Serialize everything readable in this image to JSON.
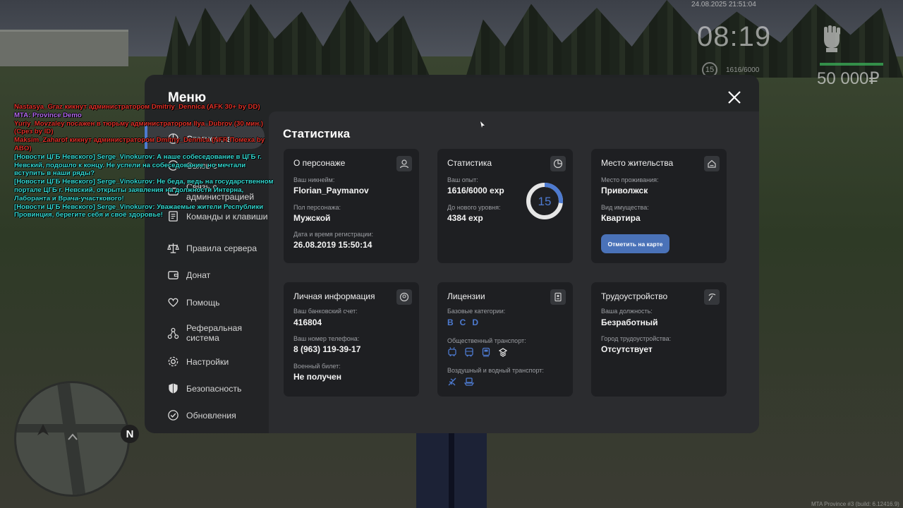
{
  "hud": {
    "datetime": "24.08.2025 21:51:04",
    "clock": "08:19",
    "level": "15",
    "exp": "1616/6000",
    "money": "50 000₽"
  },
  "chat": [
    {
      "text": "Nastasya_Graz кикнут администратором Dmitriy_Dennica (AFK 30+ by DD)",
      "color": "red"
    },
    {
      "text": "MTA: Province Demo",
      "color": "purple"
    },
    {
      "text": "Yuriy_Movzaley посажен в тюрьму администратором Ilya_Dubrov (30 мин.) (Срез by ID)",
      "color": "red"
    },
    {
      "text": "Maksim_Zaharof кикнут администратором Dmitriy_Dennica (NFR Помеха by ABO)",
      "color": "red"
    },
    {
      "text": "[Новости ЦГБ Невского] Serge_Vinokurov: А наше собеседование в ЦГБ г. Невский, подошло к концу. Не успели на собеседование, но мечтали вступить в наши ряды?",
      "color": "cyan"
    },
    {
      "text": "[Новости ЦГБ Невского] Serge_Vinokurov: Не беда, ведь на государственном портале ЦГБ г. Невский, открыты заявления на должности Интерна, Лаборанта и Врача-участкового!",
      "color": "cyan"
    },
    {
      "text": "[Новости ЦГБ Невского] Serge_Vinokurov: Уважаемые жители Республики Провинция, берегите себя и своё здоровье!",
      "color": "cyan"
    }
  ],
  "menu": {
    "title": "Меню",
    "content_title": "Статистика",
    "sidebar": [
      {
        "label": "Статистика"
      },
      {
        "label": "Связь с"
      },
      {
        "label": "Связь с администрацией"
      },
      {
        "label": "Команды и клавиши"
      },
      {
        "label": "Правила сервера"
      },
      {
        "label": "Донат"
      },
      {
        "label": "Помощь"
      },
      {
        "label": "Реферальная система"
      },
      {
        "label": "Настройки"
      },
      {
        "label": "Безопасность"
      },
      {
        "label": "Обновления"
      }
    ],
    "cards": {
      "character": {
        "title": "О персонаже",
        "nick_label": "Ваш никнейм:",
        "nick": "Florian_Paymanov",
        "gender_label": "Пол персонажа:",
        "gender": "Мужской",
        "reg_label": "Дата и время регистрации:",
        "reg": "26.08.2019 15:50:14"
      },
      "stats": {
        "title": "Статистика",
        "exp_label": "Ваш опыт:",
        "exp": "1616/6000 exp",
        "next_label": "До нового уровня:",
        "next": "4384 exp",
        "level": "15",
        "progress": 0.27
      },
      "residence": {
        "title": "Место жительства",
        "place_label": "Место проживания:",
        "place": "Приволжск",
        "property_label": "Вид имущества:",
        "property": "Квартира",
        "map_button": "Отметить на карте"
      },
      "personal": {
        "title": "Личная информация",
        "bank_label": "Ваш банковский счет:",
        "bank": "416804",
        "phone_label": "Ваш номер телефона:",
        "phone": "8 (963) 119-39-17",
        "military_label": "Военный билет:",
        "military": "Не получен"
      },
      "licenses": {
        "title": "Лицензии",
        "base_label": "Базовые категории:",
        "categories": [
          "B",
          "C",
          "D"
        ],
        "public_label": "Общественный транспорт:",
        "air_label": "Воздушный и водный транспорт:"
      },
      "job": {
        "title": "Трудоустройство",
        "position_label": "Ваша должность:",
        "position": "Безработный",
        "city_label": "Город трудоустройства:",
        "city": "Отсутствует"
      }
    }
  },
  "compass": "N",
  "watermark": "MTA Province #3 (build: 6.12416.9)",
  "colors": {
    "accent": "#4d7ad0",
    "button": "#4a72b8",
    "panel": "#1e1f22"
  }
}
